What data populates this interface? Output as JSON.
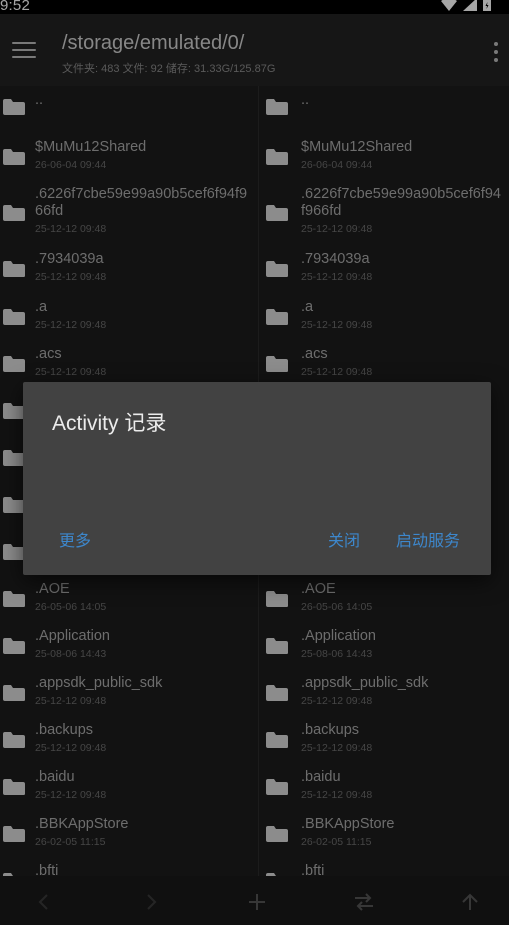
{
  "status_bar": {
    "time": "9:52",
    "icons": [
      "wifi-icon",
      "signal-icon",
      "battery-icon"
    ]
  },
  "toolbar": {
    "menu_icon": "menu-icon",
    "path": "/storage/emulated/0/",
    "summary": "文件夹: 483  文件: 92  储存: 31.33G/125.87G",
    "overflow_icon": "more-vert-icon"
  },
  "left_pane": {
    "items": [
      {
        "name": "..",
        "date": ""
      },
      {
        "name": "$MuMu12Shared",
        "date": "26-06-04 09:44"
      },
      {
        "name": ".6226f7cbe59e99a90b5cef6f94f966fd",
        "date": "25-12-12 09:48"
      },
      {
        "name": ".7934039a",
        "date": "25-12-12 09:48"
      },
      {
        "name": ".a",
        "date": "25-12-12 09:48"
      },
      {
        "name": ".acs",
        "date": "25-12-12 09:48"
      },
      {
        "name": "",
        "date": ""
      },
      {
        "name": "",
        "date": ""
      },
      {
        "name": "",
        "date": ""
      },
      {
        "name": "",
        "date": ""
      },
      {
        "name": ".AOE",
        "date": "26-05-06 14:05"
      },
      {
        "name": ".Application",
        "date": "25-08-06 14:43"
      },
      {
        "name": ".appsdk_public_sdk",
        "date": "25-12-12 09:48"
      },
      {
        "name": ".backups",
        "date": "25-12-12 09:48"
      },
      {
        "name": ".baidu",
        "date": "25-12-12 09:48"
      },
      {
        "name": ".BBKAppStore",
        "date": "26-02-05 11:15"
      },
      {
        "name": ".bfti",
        "date": ""
      }
    ]
  },
  "right_pane": {
    "items": [
      {
        "name": "..",
        "date": ""
      },
      {
        "name": "$MuMu12Shared",
        "date": "26-06-04 09:44"
      },
      {
        "name": ".6226f7cbe59e99a90b5cef6f94f966fd",
        "date": "25-12-12 09:48"
      },
      {
        "name": ".7934039a",
        "date": "25-12-12 09:48"
      },
      {
        "name": ".a",
        "date": "25-12-12 09:48"
      },
      {
        "name": ".acs",
        "date": "25-12-12 09:48"
      },
      {
        "name": "",
        "date": ""
      },
      {
        "name": "",
        "date": ""
      },
      {
        "name": "",
        "date": ""
      },
      {
        "name": "",
        "date": ""
      },
      {
        "name": ".AOE",
        "date": "26-05-06 14:05"
      },
      {
        "name": ".Application",
        "date": "25-08-06 14:43"
      },
      {
        "name": ".appsdk_public_sdk",
        "date": "25-12-12 09:48"
      },
      {
        "name": ".backups",
        "date": "25-12-12 09:48"
      },
      {
        "name": ".baidu",
        "date": "25-12-12 09:48"
      },
      {
        "name": ".BBKAppStore",
        "date": "26-02-05 11:15"
      },
      {
        "name": ".bfti",
        "date": ""
      }
    ]
  },
  "bottom_bar": {
    "buttons": [
      "back-arrow-icon",
      "forward-arrow-icon",
      "add-icon",
      "swap-icon",
      "up-arrow-icon"
    ]
  },
  "dialog": {
    "title": "Activity 记录",
    "more_label": "更多",
    "close_label": "关闭",
    "start_label": "启动服务"
  },
  "colors": {
    "accent": "#3d87cc",
    "dialog_bg": "#424242",
    "background": "#1c1c1c"
  }
}
